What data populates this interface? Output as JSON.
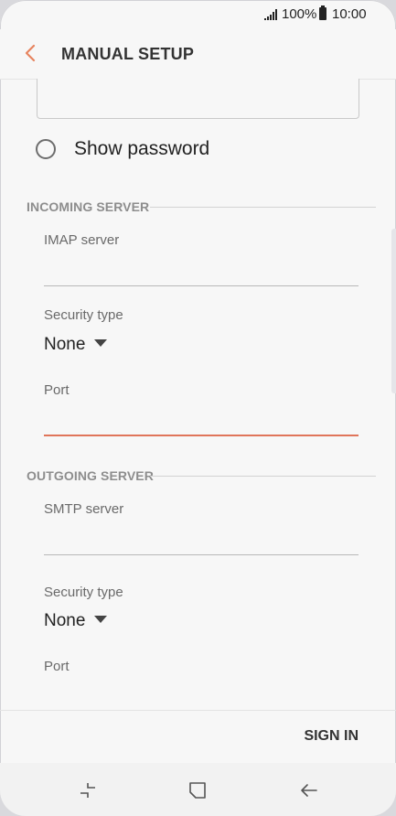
{
  "status_bar": {
    "battery_percent": "100%",
    "time": "10:00",
    "icons": [
      "signal-icon",
      "battery-icon"
    ]
  },
  "header": {
    "title": "MANUAL SETUP",
    "back_icon": "chevron-left-icon",
    "accent_color": "#e7845f"
  },
  "show_password": {
    "label": "Show password",
    "checked": false
  },
  "incoming_server": {
    "section_title": "INCOMING SERVER",
    "server_label": "IMAP server",
    "server_value": "",
    "security_label": "Security type",
    "security_value": "None",
    "port_label": "Port",
    "port_value": ""
  },
  "outgoing_server": {
    "section_title": "OUTGOING SERVER",
    "server_label": "SMTP server",
    "server_value": "",
    "security_label": "Security type",
    "security_value": "None",
    "port_label": "Port",
    "port_value": ""
  },
  "footer": {
    "sign_in_label": "SIGN IN"
  },
  "navigation": {
    "icons": [
      "recents-icon",
      "home-icon",
      "back-arrow-icon"
    ]
  }
}
